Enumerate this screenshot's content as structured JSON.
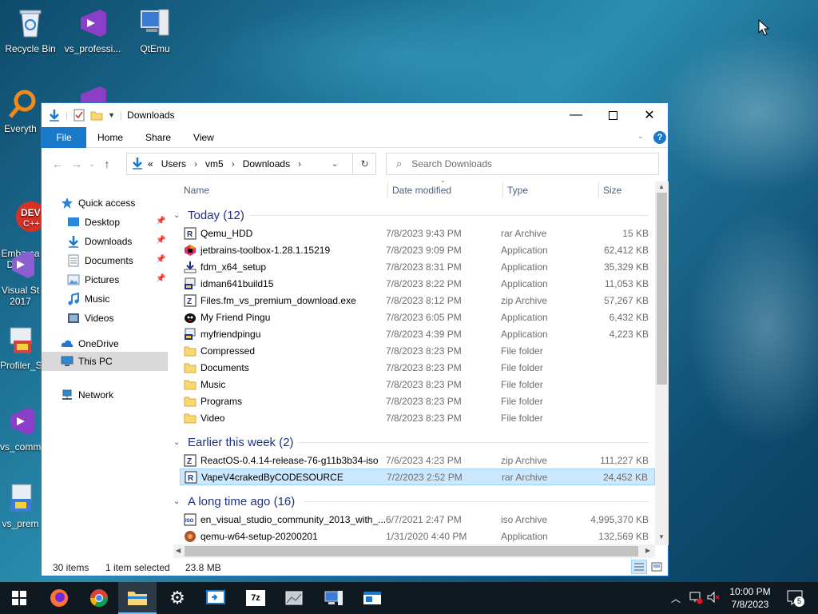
{
  "desktop": {
    "icons": [
      {
        "label": "Recycle Bin"
      },
      {
        "label": "vs_professi..."
      },
      {
        "label": "QtEmu"
      },
      {
        "label": "Everyth"
      },
      {
        "label": "Embarca\nDev-C"
      },
      {
        "label": "Visual St\n2017"
      },
      {
        "label": "Profiler_S"
      },
      {
        "label": "vs_comm"
      },
      {
        "label": "vs_prem"
      }
    ]
  },
  "window": {
    "title": "Downloads",
    "ribbon_tabs": [
      "File",
      "Home",
      "Share",
      "View"
    ],
    "address": {
      "prefix": "«",
      "crumbs": [
        "Users",
        "vm5",
        "Downloads"
      ]
    },
    "search_placeholder": "Search Downloads",
    "nav": {
      "quick_access": "Quick access",
      "items": [
        "Desktop",
        "Downloads",
        "Documents",
        "Pictures",
        "Music",
        "Videos"
      ],
      "onedrive": "OneDrive",
      "this_pc": "This PC",
      "network": "Network"
    },
    "columns": {
      "name": "Name",
      "date": "Date modified",
      "type": "Type",
      "size": "Size"
    },
    "groups": [
      {
        "label": "Today (12)",
        "rows": [
          {
            "name": "Qemu_HDD",
            "date": "7/8/2023 9:43 PM",
            "type": "rar Archive",
            "size": "15 KB",
            "icon": "rar-archive-icon"
          },
          {
            "name": "jetbrains-toolbox-1.28.1.15219",
            "date": "7/8/2023 9:09 PM",
            "type": "Application",
            "size": "62,412 KB",
            "icon": "jetbrains-icon"
          },
          {
            "name": "fdm_x64_setup",
            "date": "7/8/2023 8:31 PM",
            "type": "Application",
            "size": "35,329 KB",
            "icon": "installer-icon"
          },
          {
            "name": "idman641build15",
            "date": "7/8/2023 8:22 PM",
            "type": "Application",
            "size": "11,053 KB",
            "icon": "setup-icon"
          },
          {
            "name": "Files.fm_vs_premium_download.exe",
            "date": "7/8/2023 8:12 PM",
            "type": "zip Archive",
            "size": "57,267 KB",
            "icon": "zip-archive-icon"
          },
          {
            "name": "My Friend Pingu",
            "date": "7/8/2023 6:05 PM",
            "type": "Application",
            "size": "6,432 KB",
            "icon": "pingu-icon"
          },
          {
            "name": "myfriendpingu",
            "date": "7/8/2023 4:39 PM",
            "type": "Application",
            "size": "4,223 KB",
            "icon": "setup-icon"
          },
          {
            "name": "Compressed",
            "date": "7/8/2023 8:23 PM",
            "type": "File folder",
            "size": "",
            "icon": "folder-icon"
          },
          {
            "name": "Documents",
            "date": "7/8/2023 8:23 PM",
            "type": "File folder",
            "size": "",
            "icon": "folder-icon"
          },
          {
            "name": "Music",
            "date": "7/8/2023 8:23 PM",
            "type": "File folder",
            "size": "",
            "icon": "folder-icon"
          },
          {
            "name": "Programs",
            "date": "7/8/2023 8:23 PM",
            "type": "File folder",
            "size": "",
            "icon": "folder-icon"
          },
          {
            "name": "Video",
            "date": "7/8/2023 8:23 PM",
            "type": "File folder",
            "size": "",
            "icon": "folder-icon"
          }
        ]
      },
      {
        "label": "Earlier this week (2)",
        "rows": [
          {
            "name": "ReactOS-0.4.14-release-76-g11b3b34-iso",
            "date": "7/6/2023 4:23 PM",
            "type": "zip Archive",
            "size": "111,227 KB",
            "icon": "zip-archive-icon"
          },
          {
            "name": "VapeV4crakedByCODESOURCE",
            "date": "7/2/2023 2:52 PM",
            "type": "rar Archive",
            "size": "24,452 KB",
            "icon": "rar-archive-icon",
            "selected": true
          }
        ]
      },
      {
        "label": "A long time ago (16)",
        "rows": [
          {
            "name": "en_visual_studio_community_2013_with_...",
            "date": "6/7/2021 2:47 PM",
            "type": "iso Archive",
            "size": "4,995,370 KB",
            "icon": "iso-archive-icon"
          },
          {
            "name": "qemu-w64-setup-20200201",
            "date": "1/31/2020 4:40 PM",
            "type": "Application",
            "size": "132,569 KB",
            "icon": "qemu-icon"
          }
        ]
      }
    ],
    "status": {
      "count": "30 items",
      "selected": "1 item selected",
      "size": "23.8 MB"
    }
  },
  "taskbar": {
    "time": "10:00 PM",
    "date": "7/8/2023",
    "notification_count": "5"
  },
  "colors": {
    "accent": "#1979ca",
    "group_header": "#1e3287",
    "selection": "#cce8ff"
  }
}
